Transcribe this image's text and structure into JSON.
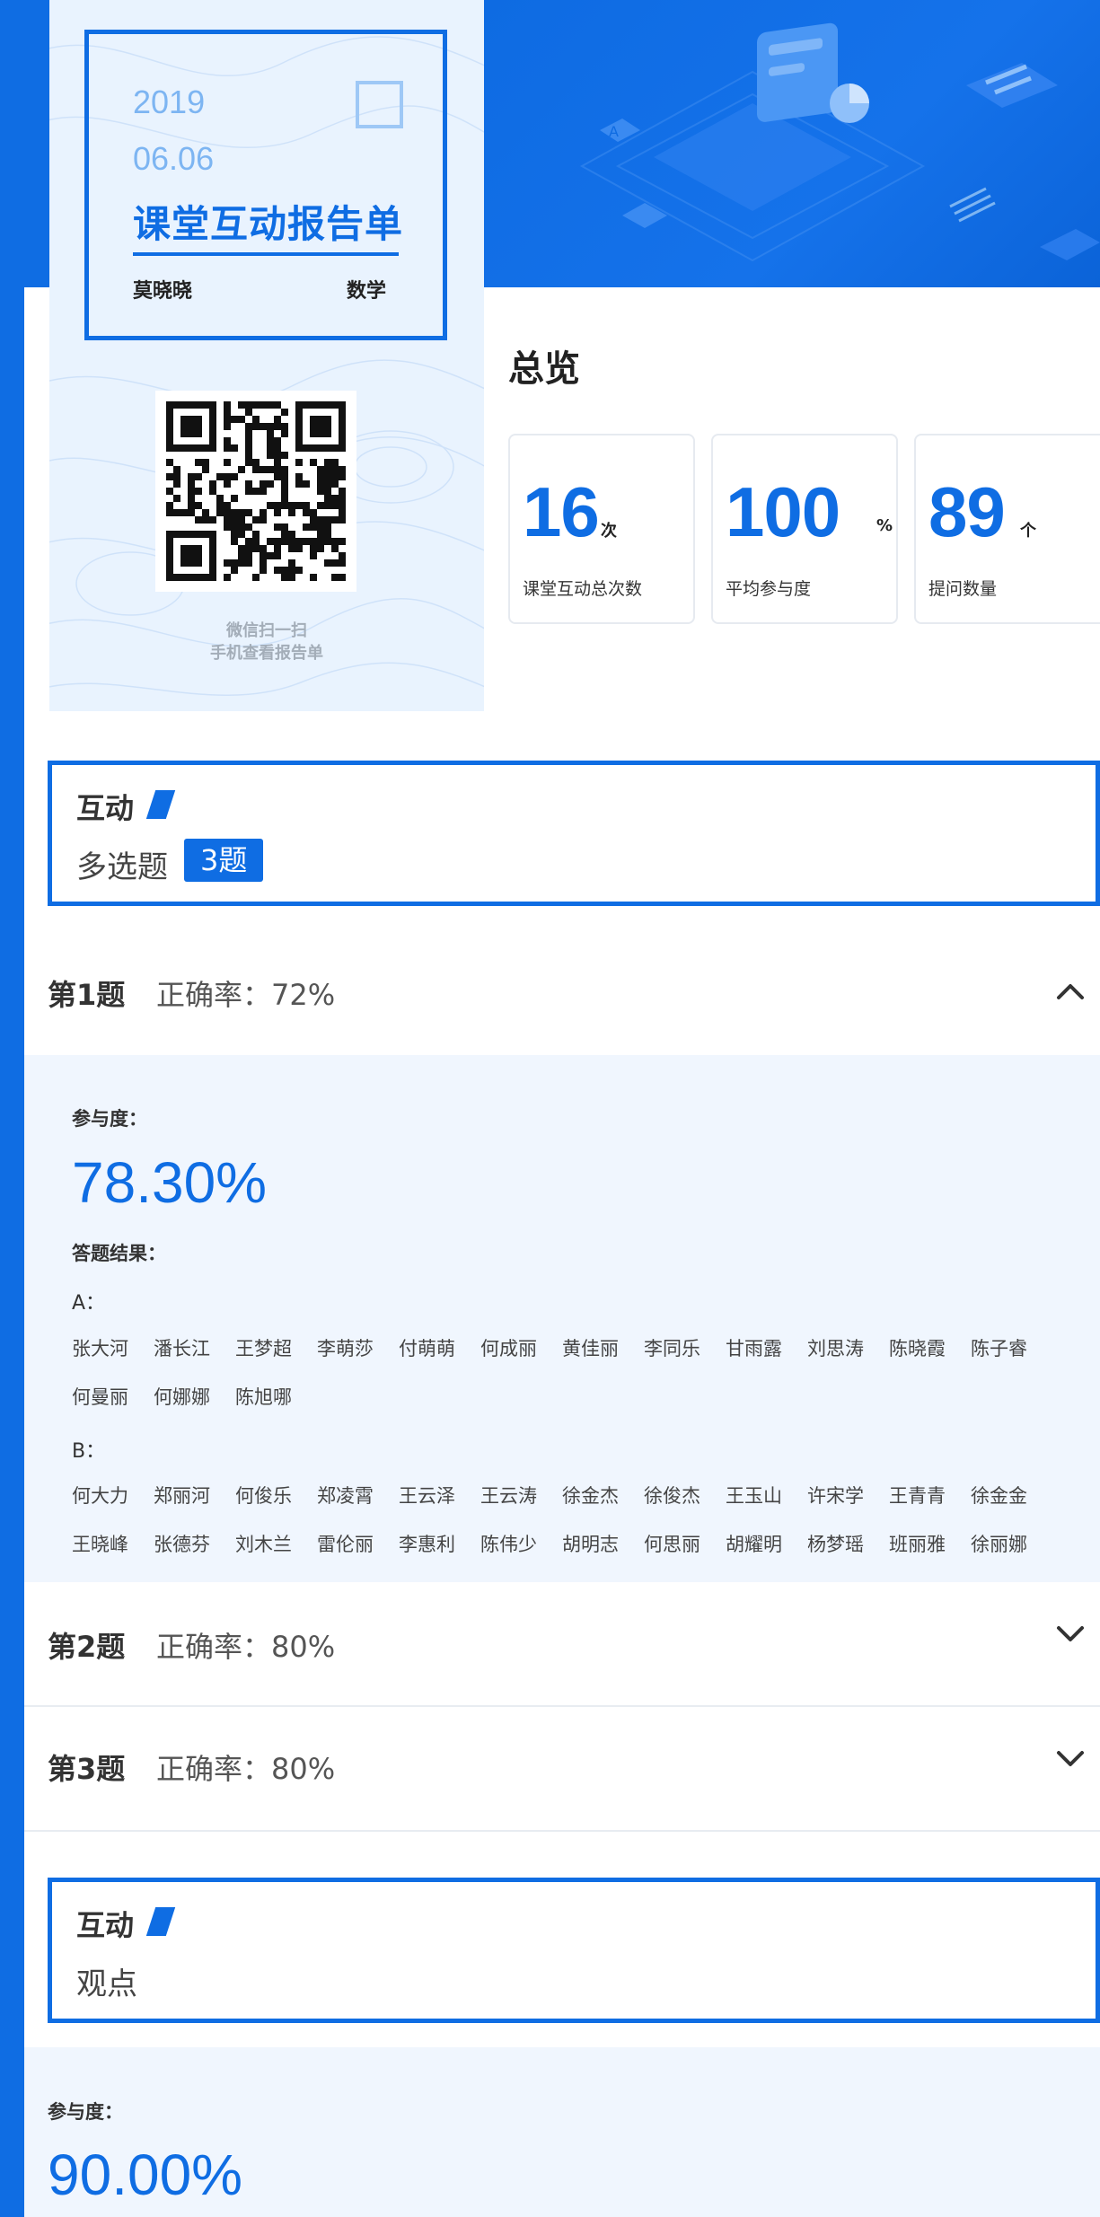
{
  "report": {
    "year": "2019",
    "date": "06.06",
    "title": "课堂互动报告单",
    "student": "莫晓晓",
    "subject": "数学",
    "qr_caption_1": "微信扫一扫",
    "qr_caption_2": "手机查看报告单"
  },
  "overview": {
    "title": "总览",
    "stats": [
      {
        "value": "16",
        "unit": "次",
        "label": "课堂互动总次数"
      },
      {
        "value": "100",
        "unit": "%",
        "label": "平均参与度"
      },
      {
        "value": "89",
        "unit": "个",
        "label": "提问数量"
      }
    ]
  },
  "interactions": [
    {
      "kind": "互动",
      "type": "多选题",
      "count": "3题",
      "questions": [
        {
          "num": "第1题",
          "accuracy": "正确率：72%",
          "expanded": true
        },
        {
          "num": "第2题",
          "accuracy": "正确率：80%",
          "expanded": false
        },
        {
          "num": "第3题",
          "accuracy": "正确率：80%",
          "expanded": false
        }
      ]
    },
    {
      "kind": "互动",
      "type": "观点"
    }
  ],
  "q1_detail": {
    "participation_label": "参与度：",
    "participation": "78.30%",
    "result_label": "答题结果：",
    "options": [
      {
        "label": "A：",
        "names": [
          "张大河",
          "潘长江",
          "王梦超",
          "李萌莎",
          "付萌萌",
          "何成丽",
          "黄佳丽",
          "李同乐",
          "甘雨露",
          "刘思涛",
          "陈晓霞",
          "陈子睿",
          "何曼丽",
          "何娜娜",
          "陈旭哪"
        ]
      },
      {
        "label": "B：",
        "names": [
          "何大力",
          "郑丽河",
          "何俊乐",
          "郑凌霄",
          "王云泽",
          "王云涛",
          "徐金杰",
          "徐俊杰",
          "王玉山",
          "许宋学",
          "王青青",
          "徐金金",
          "王晓峰",
          "张德芬",
          "刘木兰",
          "雷伦丽",
          "李惠利",
          "陈伟少",
          "胡明志",
          "何思丽",
          "胡耀明",
          "杨梦瑶",
          "班丽雅",
          "徐丽娜"
        ]
      }
    ]
  },
  "view_detail": {
    "participation_label": "参与度：",
    "participation": "90.00%"
  },
  "colors": {
    "accent": "#0f6de3",
    "card_bg": "#e9f3fe",
    "detail_bg": "#f0f6fe"
  }
}
